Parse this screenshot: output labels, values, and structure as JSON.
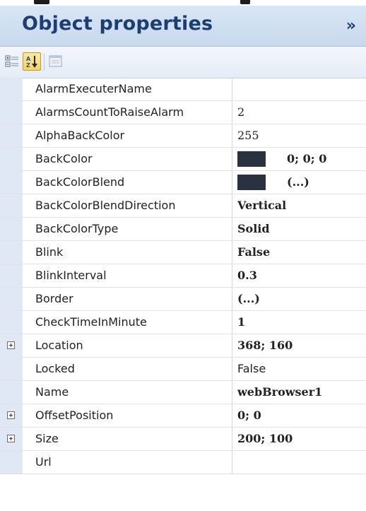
{
  "panel": {
    "title": "Object properties",
    "collapse_glyph": "»"
  },
  "toolbar": {
    "buttons": [
      {
        "name": "categorized-icon",
        "active": false
      },
      {
        "name": "alphabetical-sort-icon",
        "active": true
      },
      {
        "name": "property-pages-icon",
        "active": false
      }
    ]
  },
  "properties": [
    {
      "name": "AlarmExecuterName",
      "value": "",
      "expandable": false,
      "bold": false
    },
    {
      "name": "AlarmsCountToRaiseAlarm",
      "value": "2",
      "expandable": false,
      "bold": false
    },
    {
      "name": "AlphaBackColor",
      "value": "255",
      "expandable": false,
      "bold": false
    },
    {
      "name": "BackColor",
      "value": "0; 0; 0",
      "expandable": false,
      "bold": true,
      "swatch": "#2a3140"
    },
    {
      "name": "BackColorBlend",
      "value": "(...)",
      "expandable": false,
      "bold": true,
      "swatch": "#2a3140"
    },
    {
      "name": "BackColorBlendDirection",
      "value": "Vertical",
      "expandable": false,
      "bold": true
    },
    {
      "name": "BackColorType",
      "value": "Solid",
      "expandable": false,
      "bold": true
    },
    {
      "name": "Blink",
      "value": "False",
      "expandable": false,
      "bold": true
    },
    {
      "name": "BlinkInterval",
      "value": "0.3",
      "expandable": false,
      "bold": true
    },
    {
      "name": "Border",
      "value": "(...)",
      "expandable": false,
      "bold": true
    },
    {
      "name": "CheckTimeInMinute",
      "value": "1",
      "expandable": false,
      "bold": true
    },
    {
      "name": "Location",
      "value": "368; 160",
      "expandable": true,
      "bold": true
    },
    {
      "name": "Locked",
      "value": "False",
      "expandable": false,
      "bold": false
    },
    {
      "name": "Name",
      "value": "webBrowser1",
      "expandable": false,
      "bold": true
    },
    {
      "name": "OffsetPosition",
      "value": "0; 0",
      "expandable": true,
      "bold": true
    },
    {
      "name": "Size",
      "value": "200; 100",
      "expandable": true,
      "bold": true
    },
    {
      "name": "Url",
      "value": "",
      "expandable": false,
      "bold": false
    }
  ],
  "colors": {
    "header_bg": "#c8d9ee",
    "title_text": "#1b3f74",
    "gutter": "#dfe8f4",
    "swatch": "#2a3140"
  }
}
